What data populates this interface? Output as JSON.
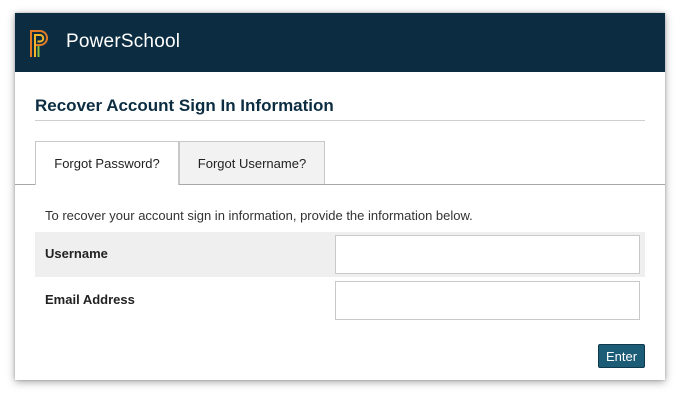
{
  "header": {
    "brand": "PowerSchool",
    "logo_icon": "powerschool-p-logo-icon",
    "background_color": "#0c2d41"
  },
  "page_title": "Recover Account Sign In Information",
  "tabs": [
    {
      "label": "Forgot Password?",
      "active": true
    },
    {
      "label": "Forgot Username?",
      "active": false
    }
  ],
  "form": {
    "instructions": "To recover your account sign in information, provide the information below.",
    "fields": [
      {
        "label": "Username",
        "value": "",
        "placeholder": ""
      },
      {
        "label": "Email Address",
        "value": "",
        "placeholder": ""
      }
    ],
    "submit_label": "Enter",
    "submit_color": "#1d5c77"
  }
}
